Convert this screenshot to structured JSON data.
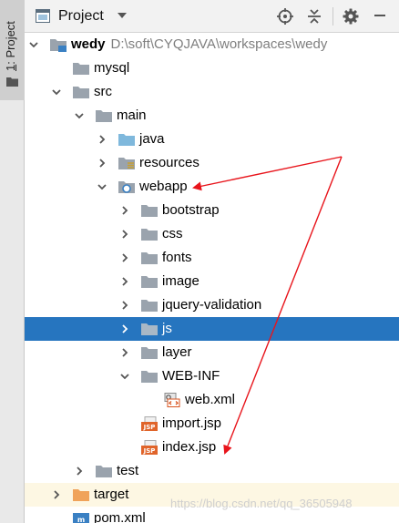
{
  "side_tab": {
    "number": "1",
    "label": ": Project"
  },
  "header": {
    "title": "Project",
    "icons": [
      "project-icon",
      "chevron-down-icon",
      "locate-icon",
      "collapse-all-icon",
      "gear-icon",
      "hide-icon"
    ]
  },
  "tree": [
    {
      "name": "wedy",
      "path": "D:\\soft\\CYQJAVA\\workspaces\\wedy",
      "type": "module",
      "expanded": true
    },
    {
      "name": "mysql",
      "type": "folder-gray"
    },
    {
      "name": "src",
      "type": "folder-gray",
      "expanded": true
    },
    {
      "name": "main",
      "type": "folder-gray",
      "expanded": true
    },
    {
      "name": "java",
      "type": "folder-blue",
      "expanded": false
    },
    {
      "name": "resources",
      "type": "folder-resources",
      "expanded": false
    },
    {
      "name": "webapp",
      "type": "folder-web",
      "expanded": true
    },
    {
      "name": "bootstrap",
      "type": "folder-gray",
      "expanded": false
    },
    {
      "name": "css",
      "type": "folder-gray",
      "expanded": false
    },
    {
      "name": "fonts",
      "type": "folder-gray",
      "expanded": false
    },
    {
      "name": "image",
      "type": "folder-gray",
      "expanded": false
    },
    {
      "name": "jquery-validation",
      "type": "folder-gray",
      "expanded": false
    },
    {
      "name": "js",
      "type": "folder-gray",
      "expanded": false,
      "selected": true
    },
    {
      "name": "layer",
      "type": "folder-gray",
      "expanded": false
    },
    {
      "name": "WEB-INF",
      "type": "folder-gray",
      "expanded": true
    },
    {
      "name": "web.xml",
      "type": "file-xml"
    },
    {
      "name": "import.jsp",
      "type": "file-jsp"
    },
    {
      "name": "index.jsp",
      "type": "file-jsp"
    },
    {
      "name": "test",
      "type": "folder-gray",
      "expanded": false
    },
    {
      "name": "target",
      "type": "folder-orange",
      "expanded": false
    },
    {
      "name": "pom.xml",
      "type": "file-maven"
    }
  ],
  "watermark": "https://blog.csdn.net/qq_36505948",
  "colors": {
    "selection": "#2675bf",
    "arrow": "#e8141b",
    "folder_gray": "#9aa3ad",
    "folder_blue": "#7fb8dc",
    "folder_orange": "#f0a35a"
  }
}
